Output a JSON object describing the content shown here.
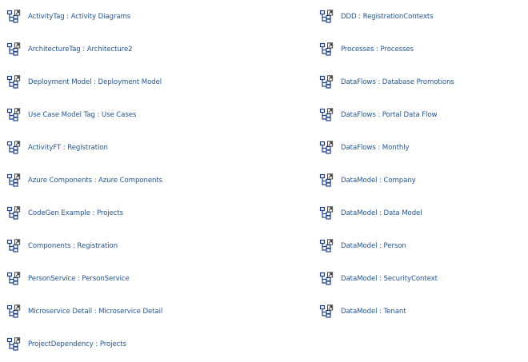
{
  "diagram_links": {
    "left": [
      {
        "label": "ActivityTag : Activity Diagrams"
      },
      {
        "label": "ArchitectureTag : Architecture2"
      },
      {
        "label": "Deployment Model : Deployment Model"
      },
      {
        "label": "Use Case Model Tag : Use Cases"
      },
      {
        "label": "ActivityFT : Registration"
      },
      {
        "label": "Azure Components : Azure Components"
      },
      {
        "label": "CodeGen Example : Projects"
      },
      {
        "label": "Components : Registration"
      },
      {
        "label": "PersonService : PersonService"
      },
      {
        "label": "Microservice Detail : Microservice Detail"
      },
      {
        "label": "ProjectDependency : Projects"
      }
    ],
    "right": [
      {
        "label": "DDD : RegistrationContexts"
      },
      {
        "label": "Processes : Processes"
      },
      {
        "label": "DataFlows : Database Promotions"
      },
      {
        "label": "DataFlows : Portal Data Flow"
      },
      {
        "label": "DataFlows : Monthly"
      },
      {
        "label": "DataModel : Company"
      },
      {
        "label": "DataModel : Data Model"
      },
      {
        "label": "DataModel : Person"
      },
      {
        "label": "DataModel : SecurityContext"
      },
      {
        "label": "DataModel : Tenant"
      }
    ]
  },
  "icon": "diagram-link-icon",
  "colors": {
    "link_text": "#1f5596",
    "icon_stroke": "#1a3f8c"
  }
}
